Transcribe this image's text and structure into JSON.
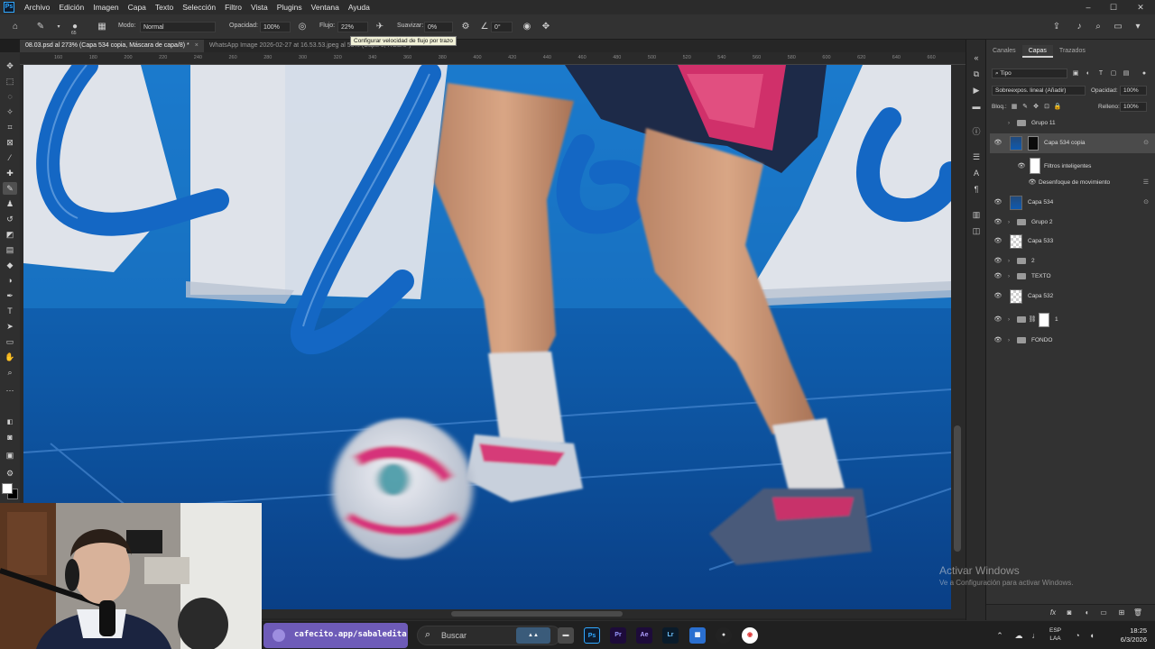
{
  "app": {
    "logo": "Ps"
  },
  "menu": [
    "Archivo",
    "Edición",
    "Imagen",
    "Capa",
    "Texto",
    "Selección",
    "Filtro",
    "Vista",
    "Plugins",
    "Ventana",
    "Ayuda"
  ],
  "window_controls": {
    "minimize": "–",
    "maximize": "☐",
    "close": "✕"
  },
  "options": {
    "brush_size": "65",
    "mode_label": "Modo:",
    "mode_value": "Normal",
    "opacity_label": "Opacidad:",
    "opacity_value": "100%",
    "flow_label": "Flujo:",
    "flow_value": "22%",
    "smoothing_label": "Suavizar:",
    "smoothing_value": "0%",
    "angle_value": "0°",
    "tooltip": "Configurar velocidad de flujo por trazo"
  },
  "doc_tabs": [
    {
      "title": "08.03.psd al 273% (Capa 534 copia, Máscara de capa/8) *",
      "close": "×"
    },
    {
      "title": "WhatsApp Image 2026-02-27 at 16.53.53.jpeg al 58% (Capa 0, RGB/8*)",
      "close": "×"
    }
  ],
  "ruler_marks": [
    "160",
    "180",
    "200",
    "220",
    "240",
    "260",
    "280",
    "300",
    "320",
    "340",
    "360",
    "380",
    "400",
    "420",
    "440",
    "460",
    "480",
    "500",
    "520",
    "540",
    "560",
    "580",
    "600",
    "620",
    "640",
    "660"
  ],
  "layers_panel": {
    "tabs": [
      "Canales",
      "Capas",
      "Trazados"
    ],
    "filter_label": "Tipo",
    "blend_mode": "Sobreexpos. lineal (Añadir)",
    "opacity_label": "Opacidad:",
    "opacity_value": "100%",
    "lock_label": "Bloq.:",
    "fill_label": "Relleno:",
    "fill_value": "100%",
    "layers": [
      {
        "name": "Grupo 11",
        "kind": "group"
      },
      {
        "name": "Capa 534 copia",
        "kind": "pixel-mask"
      },
      {
        "name": "Filtros inteligentes",
        "kind": "filters"
      },
      {
        "name": "Desenfoque de movimiento",
        "kind": "filter"
      },
      {
        "name": "Capa 534",
        "kind": "pixel"
      },
      {
        "name": "Grupo 2",
        "kind": "group"
      },
      {
        "name": "Capa 533",
        "kind": "pixel"
      },
      {
        "name": "2",
        "kind": "group"
      },
      {
        "name": "TEXTO",
        "kind": "group"
      },
      {
        "name": "Capa 532",
        "kind": "pixel"
      },
      {
        "name": "1",
        "kind": "group-mask"
      },
      {
        "name": "FONDO",
        "kind": "group"
      }
    ]
  },
  "activation": {
    "title": "Activar Windows",
    "subtitle": "Ve a Configuración para activar Windows."
  },
  "taskbar": {
    "cafecito": "cafecito.app/sabaledita",
    "search_placeholder": "Buscar",
    "apps": [
      "Ps",
      "Pr",
      "Ae",
      "Lr"
    ],
    "lang_top": "ESP",
    "lang_bottom": "LAA",
    "time": "18:25",
    "date": "6/3/2026"
  },
  "colors": {
    "accent": "#31a8ff",
    "court_blue": "#1060b0",
    "ribbon_blue": "#1467c4",
    "cafecito_purple": "#6e5bb8"
  }
}
